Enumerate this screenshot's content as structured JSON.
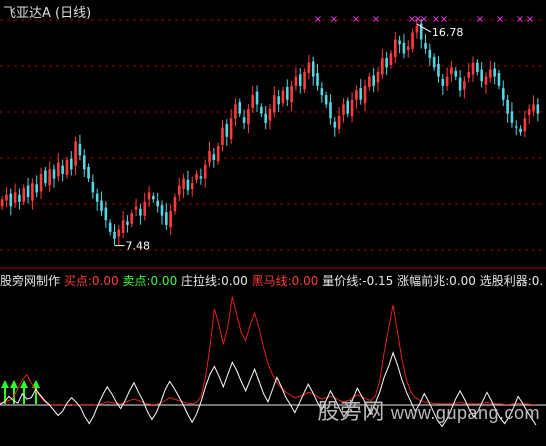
{
  "title": "飞亚达A (日线)",
  "price_chart": {
    "high_label": "16.78",
    "low_label": "7.48",
    "grid_lines": 6,
    "colors": {
      "up": "#ff3c3c",
      "down": "#54d7e3",
      "marker": "#ff40ff",
      "grid": "#a00000"
    }
  },
  "legend": [
    {
      "label": "股旁网制作",
      "color": "#e8e8e8"
    },
    {
      "label": "买点:0.00",
      "color": "#ff3c3c"
    },
    {
      "label": "卖点:0.00",
      "color": "#3cff3c"
    },
    {
      "label": "庄拉线:0.00",
      "color": "#e8e8e8"
    },
    {
      "label": "黑马线:0.00",
      "color": "#ff3c3c"
    },
    {
      "label": "量价线:-0.15",
      "color": "#e8e8e8"
    },
    {
      "label": "涨幅前兆:0.00",
      "color": "#e8e8e8"
    },
    {
      "label": "选股利器:0.",
      "color": "#e8e8e8"
    }
  ],
  "watermark": {
    "cn": "股旁网",
    "url": "www.gupang.com"
  },
  "chart_data": {
    "type": "candlestick",
    "price_close_path": [
      9.3,
      9.5,
      9.0,
      9.6,
      9.2,
      9.8,
      9.4,
      10.0,
      9.6,
      10.4,
      10.0,
      10.6,
      10.2,
      10.9,
      10.4,
      11.0,
      10.6,
      11.8,
      11.2,
      10.6,
      10.2,
      9.6,
      9.2,
      8.8,
      8.4,
      7.9,
      7.6,
      8.0,
      8.4,
      8.2,
      8.7,
      9.0,
      8.6,
      9.2,
      9.6,
      9.3,
      9.0,
      8.6,
      8.2,
      8.8,
      9.4,
      9.9,
      10.2,
      9.7,
      10.0,
      10.4,
      10.2,
      10.8,
      11.4,
      11.0,
      11.6,
      12.4,
      12.0,
      12.8,
      13.4,
      13.0,
      12.6,
      13.2,
      13.8,
      13.4,
      13.0,
      12.6,
      13.2,
      13.8,
      13.4,
      14.0,
      13.6,
      14.2,
      14.6,
      14.2,
      14.8,
      15.2,
      14.6,
      14.2,
      13.8,
      13.4,
      12.8,
      12.4,
      12.9,
      13.4,
      13.0,
      13.6,
      14.0,
      13.6,
      14.2,
      14.6,
      14.2,
      14.8,
      15.4,
      15.0,
      15.6,
      16.2,
      16.0,
      15.6,
      15.9,
      16.5,
      16.78,
      16.2,
      15.8,
      15.4,
      15.0,
      14.6,
      14.2,
      14.6,
      15.0,
      14.6,
      14.0,
      14.4,
      14.8,
      15.2,
      14.8,
      14.4,
      14.6,
      14.9,
      14.6,
      14.2,
      13.6,
      13.0,
      12.6,
      12.4,
      12.2,
      12.8,
      13.2,
      13.4,
      13.0
    ],
    "price_range": [
      6.6,
      17.3
    ],
    "high": 16.78,
    "low": 7.48,
    "indicator_white": [
      0.2,
      0.6,
      1.4,
      0.8,
      0.4,
      1.8,
      1.0,
      1.2,
      2.4,
      1.6,
      0.8,
      0.2,
      -0.6,
      -1.4,
      -0.8,
      0.4,
      1.2,
      0.6,
      -0.2,
      -1.6,
      -2.6,
      -1.4,
      0.2,
      1.6,
      2.8,
      1.8,
      0.6,
      -0.4,
      0.8,
      2.2,
      3.4,
      2.0,
      0.8,
      -0.8,
      -2.0,
      -1.0,
      0.6,
      2.4,
      3.6,
      2.6,
      1.4,
      0.2,
      -1.2,
      -2.4,
      -1.2,
      0.6,
      2.8,
      4.6,
      5.8,
      4.4,
      2.8,
      4.6,
      6.4,
      5.2,
      3.6,
      2.2,
      3.8,
      5.4,
      3.6,
      1.8,
      0.6,
      2.4,
      4.2,
      2.8,
      1.2,
      0.2,
      -1.0,
      0.4,
      1.8,
      3.2,
      2.0,
      0.6,
      -0.6,
      0.8,
      2.2,
      1.0,
      -0.4,
      -1.6,
      -0.6,
      1.0,
      2.6,
      1.4,
      0.2,
      -1.2,
      0.4,
      2.0,
      4.2,
      5.8,
      7.8,
      6.0,
      3.8,
      2.0,
      0.6,
      -0.8,
      0.4,
      1.8,
      0.6,
      -0.8,
      -2.2,
      -3.0,
      -2.0,
      -0.6,
      1.0,
      2.2,
      1.0,
      -0.4,
      -1.6,
      -0.8,
      0.6,
      2.0,
      0.8,
      -0.6,
      -1.8,
      -2.6,
      -1.6,
      -0.2,
      1.4,
      0.4,
      -0.8,
      -1.8,
      -2.8
    ],
    "indicator_red": [
      0.4,
      0.6,
      0.8,
      1.2,
      2.6,
      3.8,
      4.6,
      3.4,
      2.2,
      1.4,
      0.6,
      0.2,
      0.1,
      0.1,
      0.1,
      0.2,
      0.2,
      0.1,
      0.1,
      0.1,
      0.1,
      0.1,
      0.2,
      0.4,
      0.6,
      0.5,
      0.4,
      0.3,
      0.5,
      0.8,
      1.0,
      0.8,
      0.5,
      0.3,
      0.2,
      0.2,
      0.4,
      0.8,
      1.2,
      1.0,
      0.8,
      0.6,
      0.4,
      0.3,
      0.5,
      1.4,
      4.2,
      8.6,
      14.2,
      12.0,
      9.0,
      11.6,
      16.0,
      13.4,
      10.8,
      9.6,
      11.8,
      13.6,
      11.4,
      8.6,
      6.2,
      4.6,
      3.4,
      2.6,
      2.0,
      1.6,
      1.2,
      1.4,
      1.6,
      2.0,
      1.8,
      1.4,
      1.0,
      1.2,
      1.4,
      1.2,
      0.8,
      0.6,
      0.8,
      1.2,
      1.6,
      1.4,
      1.0,
      0.8,
      1.4,
      3.6,
      7.8,
      11.4,
      14.8,
      10.8,
      6.8,
      3.8,
      2.0,
      1.2,
      0.8,
      0.6,
      0.5,
      0.4,
      0.3,
      0.3,
      0.3,
      0.3,
      0.4,
      0.5,
      0.4,
      0.3,
      0.3,
      0.3,
      0.4,
      0.5,
      0.4,
      0.3,
      0.3,
      0.2,
      0.2,
      0.3,
      0.4,
      0.3,
      0.3,
      0.2,
      0.2
    ],
    "indicator_range": [
      -5,
      17
    ]
  }
}
